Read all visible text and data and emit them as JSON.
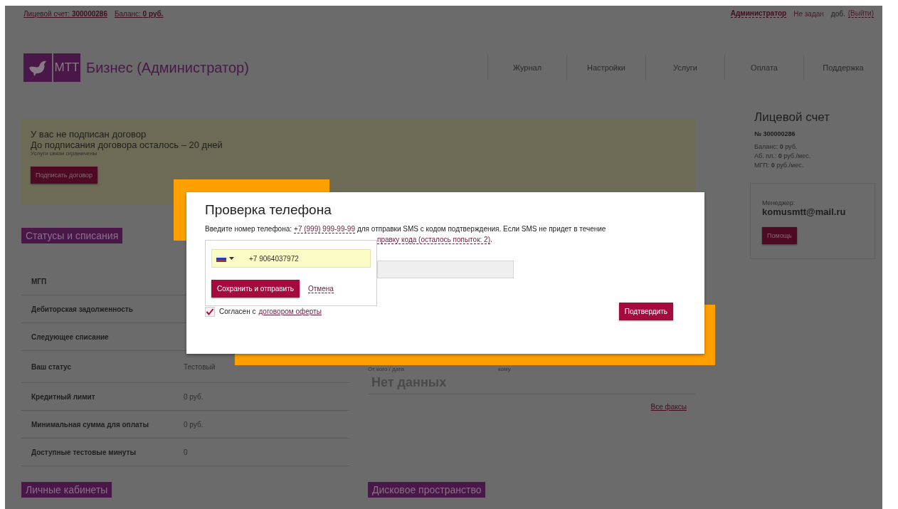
{
  "top_bar": {
    "account_link": "Лицевой счет: **300000286**",
    "balance_link": "Баланс: **0 руб.**",
    "role_link": "Администратор",
    "phone_status": "Не задан",
    "extension": "доб.",
    "logout_link": "(Выйти)"
  },
  "header": {
    "logo_text": "МТТ",
    "title": "Бизнес (Администратор)",
    "nav": [
      "Журнал",
      "Настройки",
      "Услуги",
      "Оплата",
      "Поддержка"
    ]
  },
  "notice": {
    "lines": [
      "У вас не подписан договор",
      "До подписания договора осталось – 20 дней"
    ],
    "note": "Услуги связи ограничены",
    "button": "Подписать договор"
  },
  "status_section": {
    "heading": "Статусы и списания",
    "rows": [
      {
        "label": "МГП"
      },
      {
        "label": "Дебиторская задолженность"
      },
      {
        "label": "Следующее списание"
      },
      {
        "label": "Ваш статус",
        "value": "Тестовый"
      },
      {
        "label": "Кредитный лимит",
        "value": "0 руб."
      },
      {
        "label": "Минимальная сумма для оплаты",
        "value": "0 руб."
      },
      {
        "label": "Доступные тестовые минуты",
        "value": "0"
      }
    ]
  },
  "fax_section": {
    "columns": [
      "От кого / дата",
      "кому"
    ],
    "empty": "Нет данных",
    "link": "Все факсы"
  },
  "bottom_headings": [
    "Личные кабинеты",
    "Дисковое пространство"
  ],
  "account": {
    "title": "Лицевой счет",
    "number": "№ 300000286",
    "lines": [
      "Баланс: **0** руб.",
      "Аб. пл.: **0** руб./мес.",
      "МГП: **0** руб./мес."
    ]
  },
  "manager": {
    "label": "Менеджер:",
    "email": "komusmtt@mail.ru",
    "button": "Помощь"
  },
  "dialog": {
    "title": "Проверка телефона",
    "text_before": "Введите номер телефона:",
    "phone_link": "+7 (999) 999-99-99",
    "text_after": "для отправки SMS с кодом подтверждения. Если SMS не придет в течение",
    "resend_link": "правку кода (осталось попыток: 2)",
    "resend_tail": ".",
    "agree": {
      "checked": true,
      "text": "Согласен с",
      "link": "договором оферты"
    },
    "confirm_button": "Подтвердить",
    "phone_editor": {
      "phone": "+7 9064037972",
      "save_button": "Сохранить и отправить",
      "cancel_link": "Отмена"
    }
  }
}
